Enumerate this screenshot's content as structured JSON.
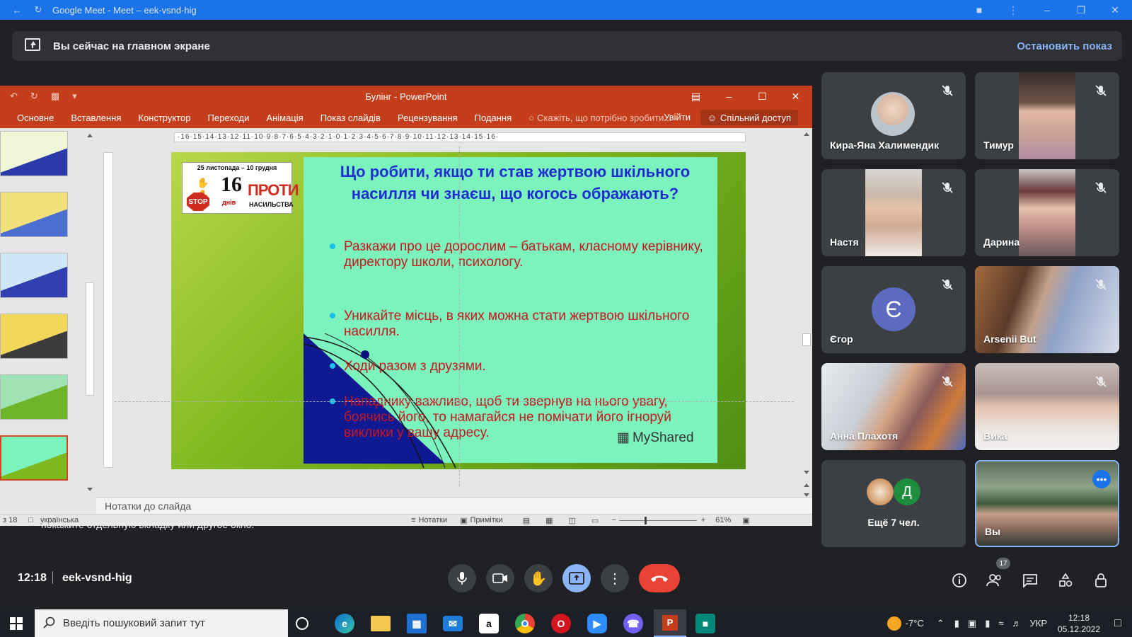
{
  "browser": {
    "title": "Google Meet - Meet – eek-vsnd-hig"
  },
  "banner": {
    "text": "Вы сейчас на главном экране",
    "stop_label": "Остановить показ"
  },
  "ppt": {
    "title": "Булінг - PowerPoint",
    "tabs": [
      "Основне",
      "Вставлення",
      "Конструктор",
      "Переходи",
      "Анімація",
      "Показ слайдів",
      "Рецензування",
      "Подання"
    ],
    "tell_me": "Скажіть, що потрібно зробити...",
    "login": "Увійти",
    "share": "Спільний доступ",
    "ruler": "·16·15·14·13·12·11·10·9·8·7·6·5·4·3·2·1·0·1·2·3·4·5·6·7·8·9·10·11·12·13·14·15·16·",
    "notes_placeholder": "Нотатки до слайда",
    "status": {
      "slide": "з 18",
      "lang": "українська",
      "notes_btn": "Нотатки",
      "comments_btn": "Примітки",
      "zoom": "61%"
    }
  },
  "slide": {
    "badge_date": "25 листопада – 10 грудня",
    "badge_16": "16",
    "badge_days": "днів",
    "badge_proty": "ПРОТИ",
    "badge_nasylstva": "НАСИЛЬСТВА",
    "badge_stop": "STOP",
    "title": "Що робити, якщо ти став жертвою шкільного насилля чи знаєш, що когось ображають?",
    "bullets": [
      "Разкажи про це дорослим – батькам, класному керівнику, директору школи, психологу.",
      "Уникайте місць, в яких можна стати жертвою шкільного насилля.",
      "Ходи разом з друзями.",
      "Нападнику важливо, щоб ти звернув на нього увагу, боячись його, то намагайся не помічати його ігноруй виклики у вашу адресу."
    ],
    "watermark": "MyShared"
  },
  "behind_text": "покажите отдельную вкладку или другое окно.",
  "participants": [
    {
      "name": "Кира-Яна Халимендик"
    },
    {
      "name": "Тимур"
    },
    {
      "name": "Настя"
    },
    {
      "name": "Дарина"
    },
    {
      "name": "Єгор",
      "initial": "Є"
    },
    {
      "name": "Arsenii But"
    },
    {
      "name": "Анна Плахотя"
    },
    {
      "name": "Вика"
    },
    {
      "name": "Ещё 7 чел.",
      "initial": "Д"
    },
    {
      "name": "Вы"
    }
  ],
  "meet": {
    "time": "12:18",
    "code": "eek-vsnd-hig",
    "people_count": "17"
  },
  "taskbar": {
    "search_placeholder": "Введіть пошуковий запит тут",
    "weather": "-7°C",
    "lang": "УКР",
    "time": "12:18",
    "date": "05.12.2022"
  },
  "colors": {
    "meet_bg": "#202124",
    "ppt_red": "#c43e1c",
    "end_call": "#ea4335",
    "present_blue": "#8ab4f8",
    "slide_title": "#1f2ed0",
    "slide_text": "#c8161d"
  }
}
